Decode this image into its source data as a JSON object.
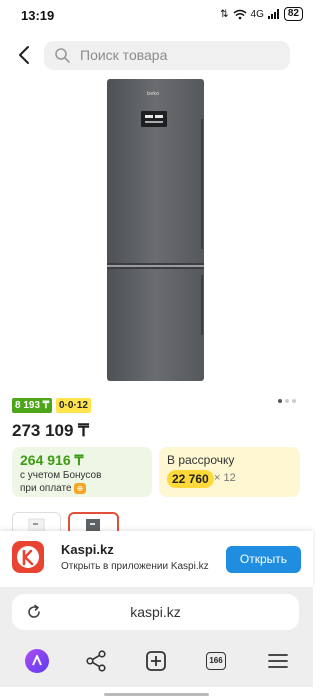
{
  "status_bar": {
    "time": "13:19",
    "network": "4G",
    "battery": "82"
  },
  "search": {
    "placeholder": "Поиск товара"
  },
  "product": {
    "bonus_badge": "8 193 ₸",
    "installment_badge": "0·0·12",
    "price": "273 109 ₸",
    "image_count": 3,
    "active_image": 1
  },
  "bonus_card": {
    "price": "264 916 ₸",
    "line1": "с учетом Бонусов",
    "line2": "при оплате"
  },
  "installment_card": {
    "title": "В рассрочку",
    "monthly": "22 760",
    "months": "× 12"
  },
  "app_banner": {
    "title": "Kaspi.kz",
    "subtitle": "Открыть в приложении Kaspi.kz",
    "open_label": "Открыть"
  },
  "browser": {
    "url": "kaspi.kz",
    "tab_count": "166"
  },
  "colors": {
    "green_badge": "#4da51a",
    "yellow_badge": "#ffe44d",
    "bonus_text": "#3b9b12",
    "kaspi_red": "#e94431",
    "open_button": "#1f8de0"
  }
}
